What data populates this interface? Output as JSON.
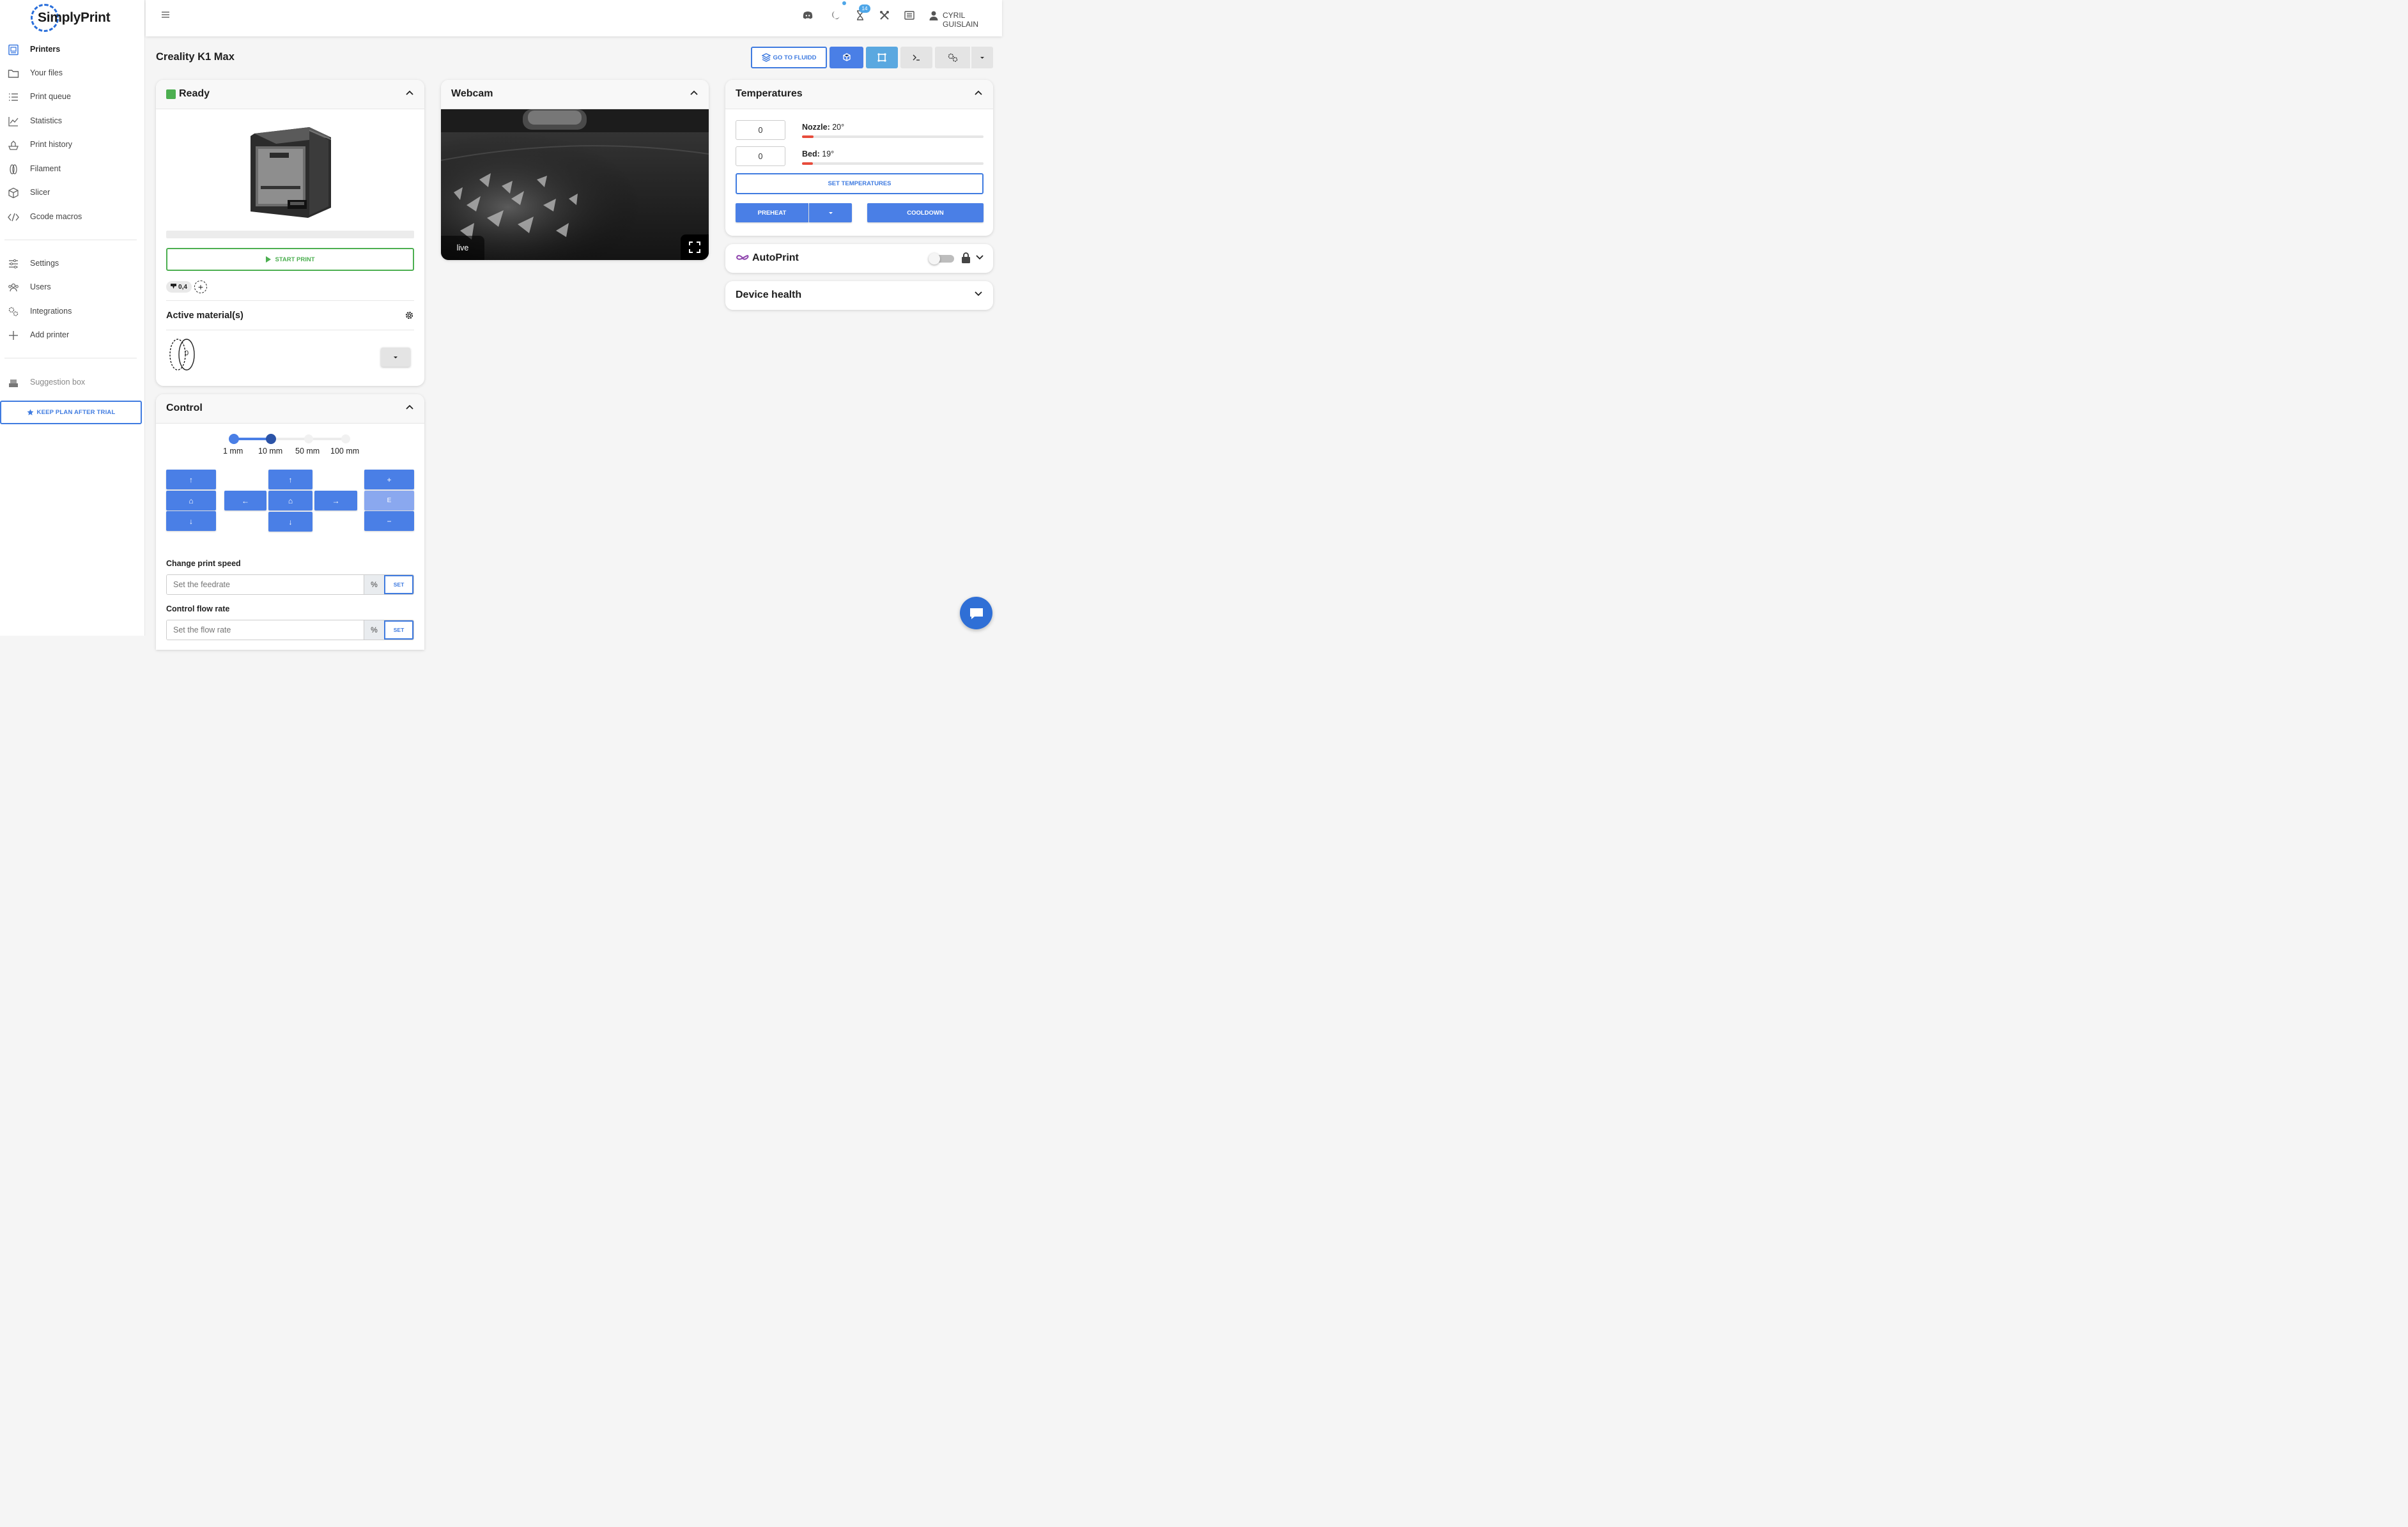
{
  "brand": {
    "name": "SimplyPrint"
  },
  "sidebar": {
    "items": [
      {
        "label": "Printers",
        "icon": "printer-icon"
      },
      {
        "label": "Your files",
        "icon": "folder-icon"
      },
      {
        "label": "Print queue",
        "icon": "list-icon"
      },
      {
        "label": "Statistics",
        "icon": "chart-icon"
      },
      {
        "label": "Print history",
        "icon": "history-icon"
      },
      {
        "label": "Filament",
        "icon": "spool-icon"
      },
      {
        "label": "Slicer",
        "icon": "cube-icon"
      },
      {
        "label": "Gcode macros",
        "icon": "code-icon"
      }
    ],
    "settings_items": [
      {
        "label": "Settings",
        "icon": "sliders-icon"
      },
      {
        "label": "Users",
        "icon": "users-icon"
      },
      {
        "label": "Integrations",
        "icon": "gears-icon"
      },
      {
        "label": "Add printer",
        "icon": "plus-icon"
      }
    ],
    "suggestion": "Suggestion box",
    "keep_plan": "KEEP PLAN AFTER TRIAL"
  },
  "topbar": {
    "notification_count": "14",
    "user": "CYRIL GUISLAIN"
  },
  "page": {
    "title": "Creality K1 Max",
    "go_fluidd": "GO TO FLUIDD"
  },
  "status_card": {
    "status": "Ready",
    "status_color": "#4caf50",
    "start_print": "START PRINT",
    "nozzle_size": "0,4",
    "active_materials": "Active material(s)",
    "spool_index": "0"
  },
  "control_card": {
    "title": "Control",
    "step_options": [
      "1 mm",
      "10 mm",
      "50 mm",
      "100 mm"
    ],
    "selected_step": "10 mm",
    "extruder_label": "E",
    "change_speed": "Change print speed",
    "speed_placeholder": "Set the feedrate",
    "flow_label": "Control flow rate",
    "flow_placeholder": "Set the flow rate",
    "percent": "%",
    "set": "SET"
  },
  "webcam_card": {
    "title": "Webcam",
    "live": "live"
  },
  "temperatures_card": {
    "title": "Temperatures",
    "nozzle_input": "0",
    "bed_input": "0",
    "nozzle_label": "Nozzle:",
    "nozzle_value": "20°",
    "bed_label": "Bed:",
    "bed_value": "19°",
    "nozzle_fill": 0.065,
    "bed_fill": 0.06,
    "set_temps": "SET TEMPERATURES",
    "preheat": "PREHEAT",
    "cooldown": "COOLDOWN"
  },
  "autoprint_card": {
    "title": "AutoPrint",
    "enabled": false
  },
  "health_card": {
    "title": "Device health"
  },
  "colors": {
    "accent": "#4a7fe6",
    "success": "#4caf50",
    "danger": "#e74c3c",
    "autoprint": "#8e44ad"
  }
}
